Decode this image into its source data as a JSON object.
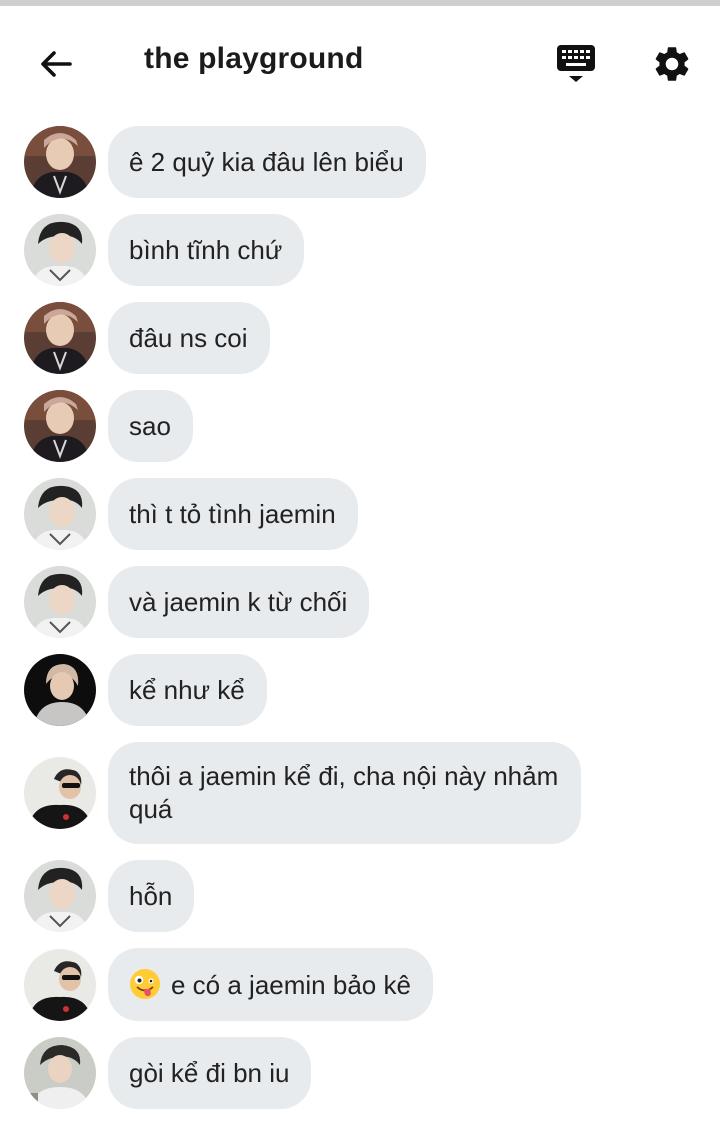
{
  "header": {
    "title": "the playground",
    "back_icon": "arrow-left-icon",
    "keyboard_icon": "keyboard-icon",
    "settings_icon": "gear-icon"
  },
  "colors": {
    "bubble_bg": "#e8ebee",
    "text": "#222222",
    "icon": "#111111"
  },
  "messages": [
    {
      "avatar": "a",
      "text": "ê 2 quỷ kia đâu lên biểu"
    },
    {
      "avatar": "b",
      "text": "bình tĩnh chứ"
    },
    {
      "avatar": "a",
      "text": "đâu ns coi"
    },
    {
      "avatar": "a",
      "text": "sao"
    },
    {
      "avatar": "b",
      "text": "thì t tỏ tình jaemin"
    },
    {
      "avatar": "b",
      "text": "và jaemin k từ chối"
    },
    {
      "avatar": "c",
      "text": "kể như kể"
    },
    {
      "avatar": "d",
      "text": "thôi a jaemin kể đi, cha nội này nhảm quá"
    },
    {
      "avatar": "b",
      "text": "hỗn"
    },
    {
      "avatar": "d",
      "emoji": "zany-face-emoji",
      "text": "e có a jaemin bảo kê"
    },
    {
      "avatar": "e",
      "text": "gòi kể đi bn iu"
    }
  ]
}
